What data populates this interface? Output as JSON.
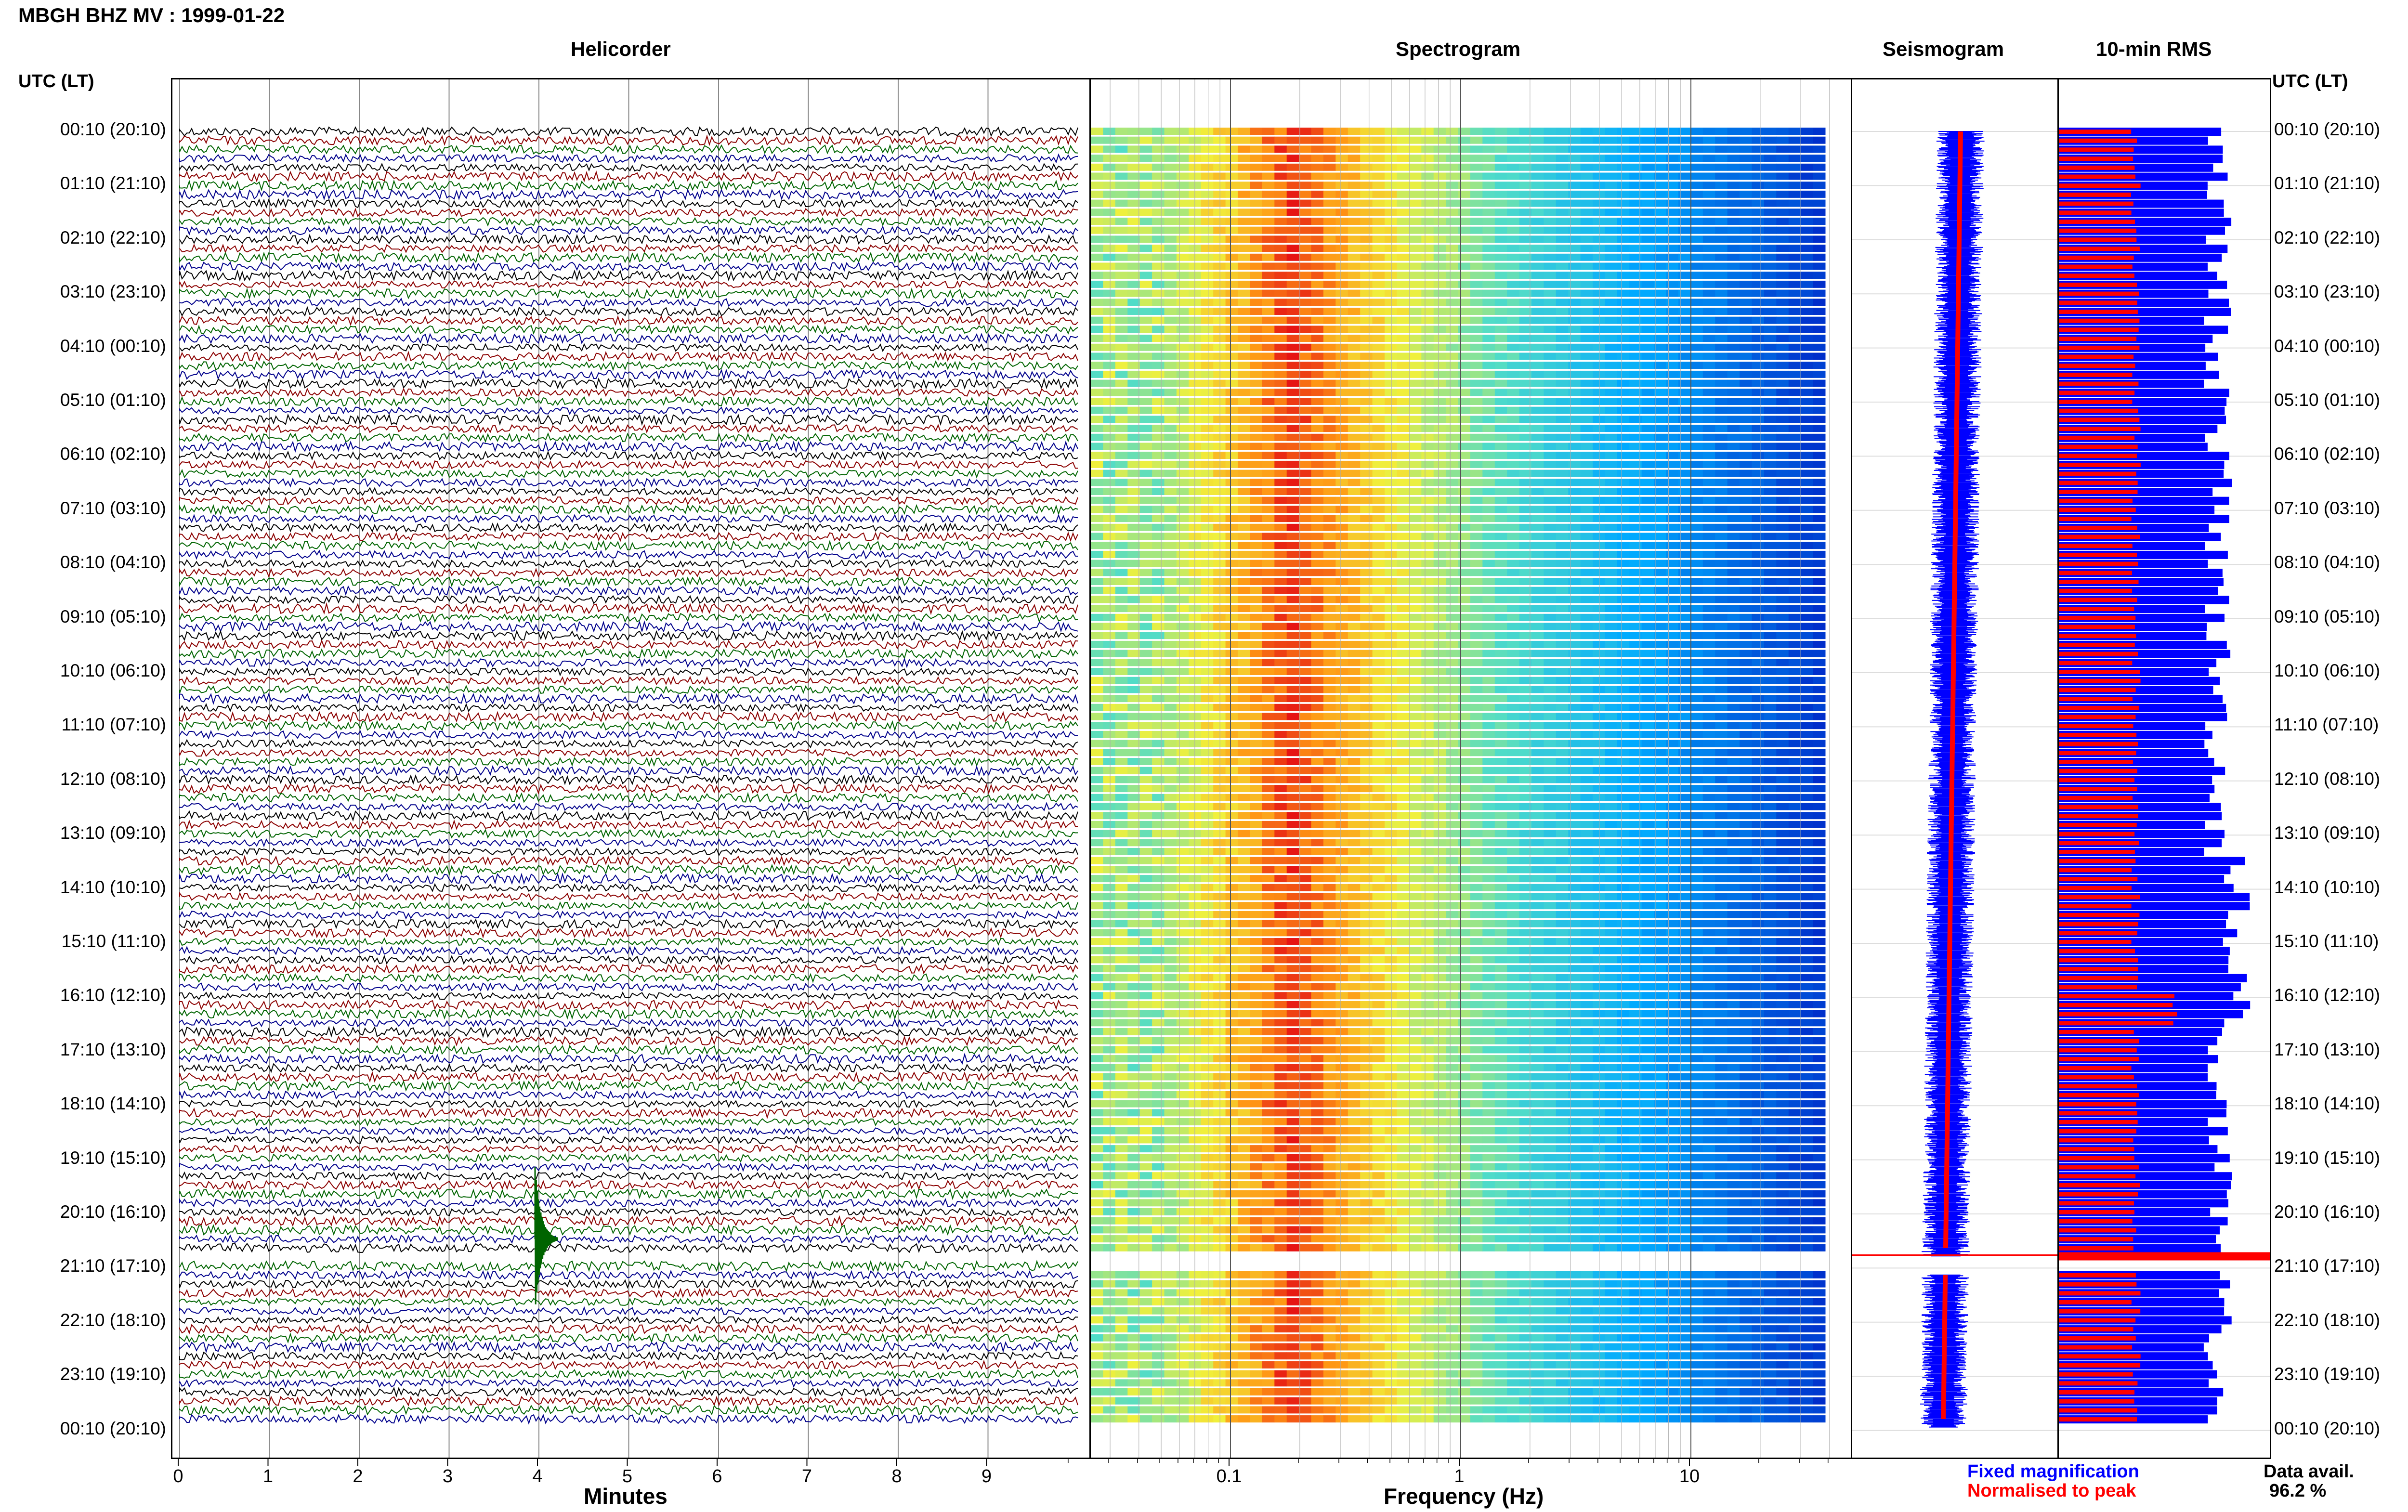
{
  "header": {
    "title": "MBGH BHZ MV : 1999-01-22"
  },
  "panels": {
    "helicorder": "Helicorder",
    "spectrogram": "Spectrogram",
    "seismogram": "Seismogram",
    "rms": "10-min RMS"
  },
  "axis": {
    "utc_label": "UTC (LT)",
    "minutes_label": "Minutes",
    "frequency_label": "Frequency (Hz)",
    "minutes_ticks": [
      "0",
      "1",
      "2",
      "3",
      "4",
      "5",
      "6",
      "7",
      "8",
      "9"
    ],
    "frequency_ticks": [
      "0.1",
      "1",
      "10"
    ]
  },
  "time_labels": [
    "00:10 (20:10)",
    "01:10 (21:10)",
    "02:10 (22:10)",
    "03:10 (23:10)",
    "04:10 (00:10)",
    "05:10 (01:10)",
    "06:10 (02:10)",
    "07:10 (03:10)",
    "08:10 (04:10)",
    "09:10 (05:10)",
    "10:10 (06:10)",
    "11:10 (07:10)",
    "12:10 (08:10)",
    "13:10 (09:10)",
    "14:10 (10:10)",
    "15:10 (11:10)",
    "16:10 (12:10)",
    "17:10 (13:10)",
    "18:10 (14:10)",
    "19:10 (15:10)",
    "20:10 (16:10)",
    "21:10 (17:10)",
    "22:10 (18:10)",
    "23:10 (19:10)",
    "00:10 (20:10)"
  ],
  "legend": {
    "fixed": "Fixed magnification",
    "normalised": "Normalised to peak",
    "availability_label": "Data avail.",
    "availability_value": "96.2 %"
  },
  "colors": {
    "trace": [
      "#000000",
      "#8b0000",
      "#006400",
      "#00008b"
    ],
    "fixed": "#0000ff",
    "normalised": "#ff0000"
  },
  "chart_data": {
    "type": "heatmap",
    "title": "MBGH BHZ MV : 1999-01-22",
    "xlabel_helicorder": "Minutes",
    "xlabel_spectrogram": "Frequency (Hz)",
    "ylabel": "UTC (LT)",
    "helicorder_xlim": [
      0,
      10
    ],
    "spectrogram_xlim_hz": [
      0.02,
      40
    ],
    "spectrogram_xscale": "log",
    "data_gap": {
      "start": "20:50",
      "end": "21:10"
    },
    "data_availability_percent": 96.2,
    "series": [
      {
        "name": "Fixed magnification",
        "color": "#0000ff"
      },
      {
        "name": "Normalised to peak",
        "color": "#ff0000"
      }
    ]
  }
}
